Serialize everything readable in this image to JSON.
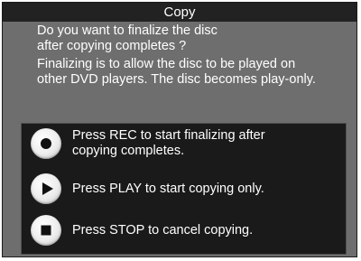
{
  "dialog": {
    "title": "Copy",
    "question_lines": [
      "Do you want to finalize the disc",
      "after copying completes ?"
    ],
    "info_lines": [
      "Finalizing is to allow the disc to be played on",
      "other DVD players. The disc becomes play-only."
    ]
  },
  "options": {
    "rec": {
      "icon": "rec-button-icon",
      "label_lines": [
        "Press REC to start finalizing after",
        "copying completes."
      ]
    },
    "play": {
      "icon": "play-button-icon",
      "label": "Press PLAY to start copying only."
    },
    "stop": {
      "icon": "stop-button-icon",
      "label": "Press STOP to cancel copying."
    }
  },
  "colors": {
    "title_bar": "#222222",
    "dialog_body": "#6e6e6e",
    "options_panel": "#1a1a1a",
    "text": "#ffffff"
  }
}
